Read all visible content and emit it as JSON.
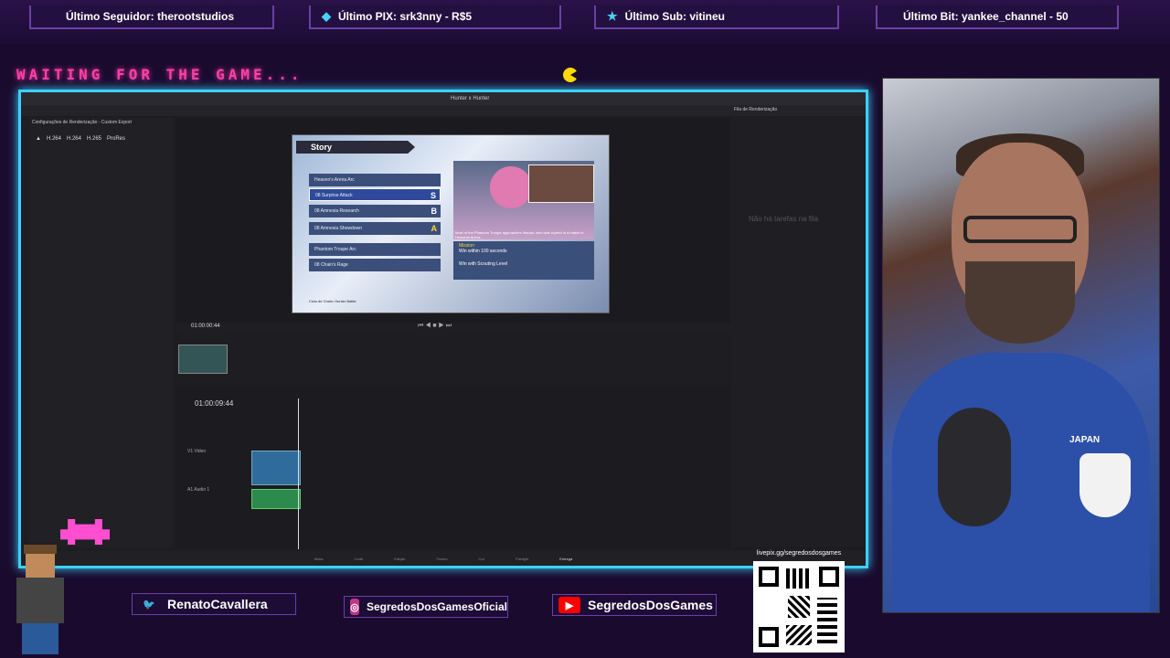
{
  "alerts": [
    {
      "label": "Último Seguidor: therootstudios",
      "icon": "user-icon"
    },
    {
      "label": "Último PIX: srk3nny - R$5",
      "icon": "pix-icon"
    },
    {
      "label": "Último Sub: vitineu",
      "icon": "star-icon"
    },
    {
      "label": "Último Bit: yankee_channel - 50",
      "icon": "bit-icon"
    }
  ],
  "waiting_text": "WAITING FOR THE GAME...",
  "editor": {
    "window_title": "Hunter x Hunter",
    "render_settings_title": "Configurações de Renderização - Custom Export",
    "presets": [
      "H.264",
      "H.264",
      "H.265",
      "ProRes"
    ],
    "render_queue_title": "Fila de Renderização",
    "render_queue_empty": "Não há tarefas na fila",
    "timecode_preview": "01:00:00:44",
    "timecode_timeline": "01:00:09:44",
    "track_video": "V1  Video",
    "track_audio": "A1  Audio 1",
    "page_tabs": [
      "Mídia",
      "Corte",
      "Edição",
      "Fusion",
      "Cor",
      "Fairlight",
      "Entrega"
    ]
  },
  "game": {
    "header": "Story",
    "menu": [
      {
        "label": "Heaven's Arena Arc",
        "grade": ""
      },
      {
        "label": "08 Surprise Attack",
        "grade": "S",
        "selected": true
      },
      {
        "label": "08 Amnesia Research",
        "grade": "B"
      },
      {
        "label": "08 Amnesia Showdown",
        "grade": "A"
      },
      {
        "label": "Phantom Troupe Arc",
        "grade": ""
      },
      {
        "label": "08 Chain's Rage",
        "grade": ""
      }
    ],
    "description": "Most of the Phantom Troupe approaches Hisoka, who was injured in a match in Heavens Arena.",
    "mission_title": "Mission",
    "mission_line": "Win within 100 seconds",
    "mission_line2": "Win with Scouting Level",
    "footer": "Ciclo de Chain: Hunter Battle"
  },
  "socials": [
    {
      "label": "RenatoCavallera",
      "icon": "twitter-icon",
      "color": "#1da1f2"
    },
    {
      "label": "SegredosDosGamesOficial",
      "icon": "instagram-icon",
      "color": "#c13584"
    },
    {
      "label": "SegredosDosGames",
      "icon": "youtube-icon",
      "color": "#ff0000"
    }
  ],
  "qr_label": "livepix.gg/segredosdosgames",
  "webcam_shirt_text": "JAPAN",
  "colors": {
    "accent": "#3ad1ff",
    "frame_bg": "#1a0b2e",
    "alert_border": "#6a3fa8"
  }
}
